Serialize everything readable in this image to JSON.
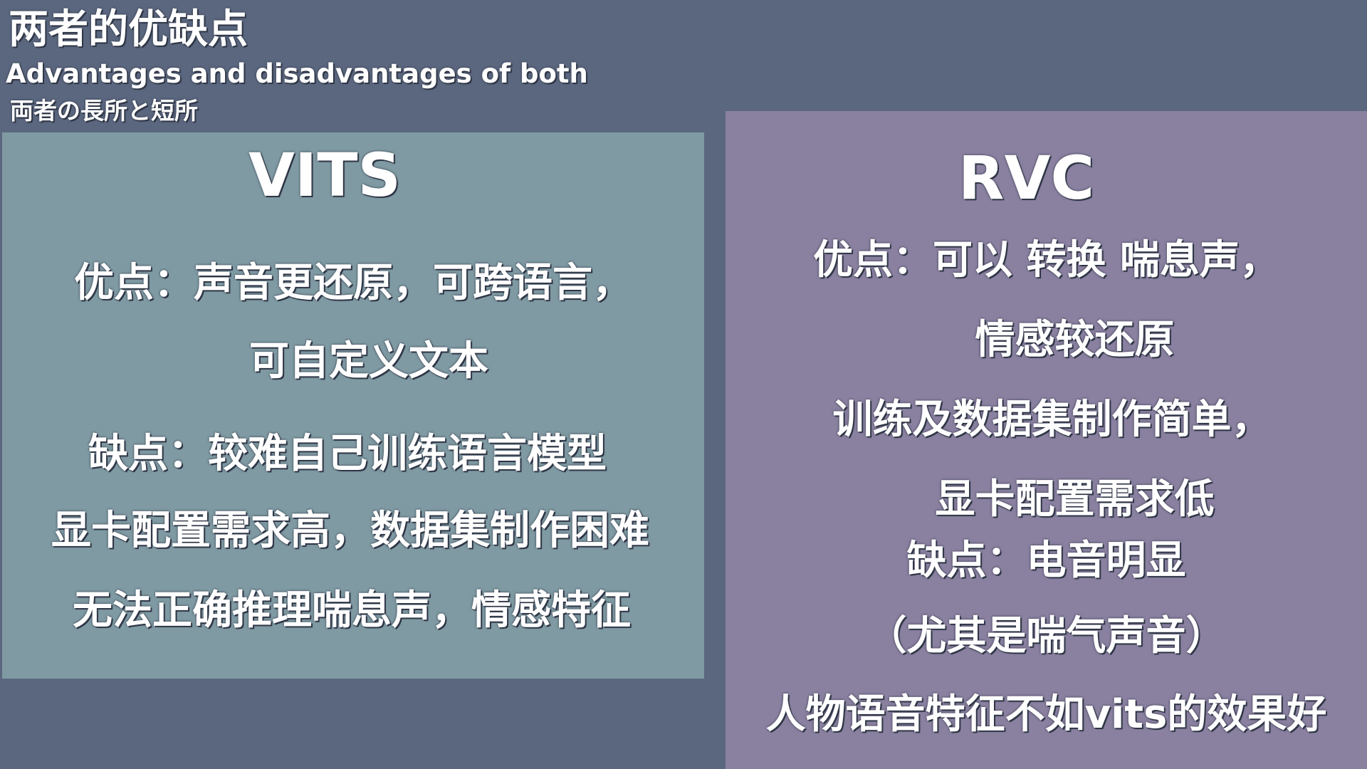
{
  "header": {
    "title_zh": "两者的优缺点",
    "title_en": "Advantages and disadvantages of both",
    "title_ja": "両者の長所と短所"
  },
  "vits": {
    "title": "VITS",
    "lines": [
      "优点：声音更还原，可跨语言，",
      "可自定义文本",
      "缺点：较难自己训练语言模型",
      "显卡配置需求高，数据集制作困难",
      "无法正确推理喘息声，情感特征"
    ]
  },
  "rvc": {
    "title": "RVC",
    "lines": [
      "优点：可以 转换 喘息声，",
      "情感较还原",
      "训练及数据集制作简单，",
      "显卡配置需求低",
      "缺点：电音明显",
      "（尤其是喘气声音）",
      "人物语音特征不如vits的效果好"
    ]
  },
  "colors": {
    "background": "#5b677f",
    "vits_panel": "#7f9aa3",
    "rvc_panel": "#8a80a0",
    "text": "#ffffff"
  }
}
